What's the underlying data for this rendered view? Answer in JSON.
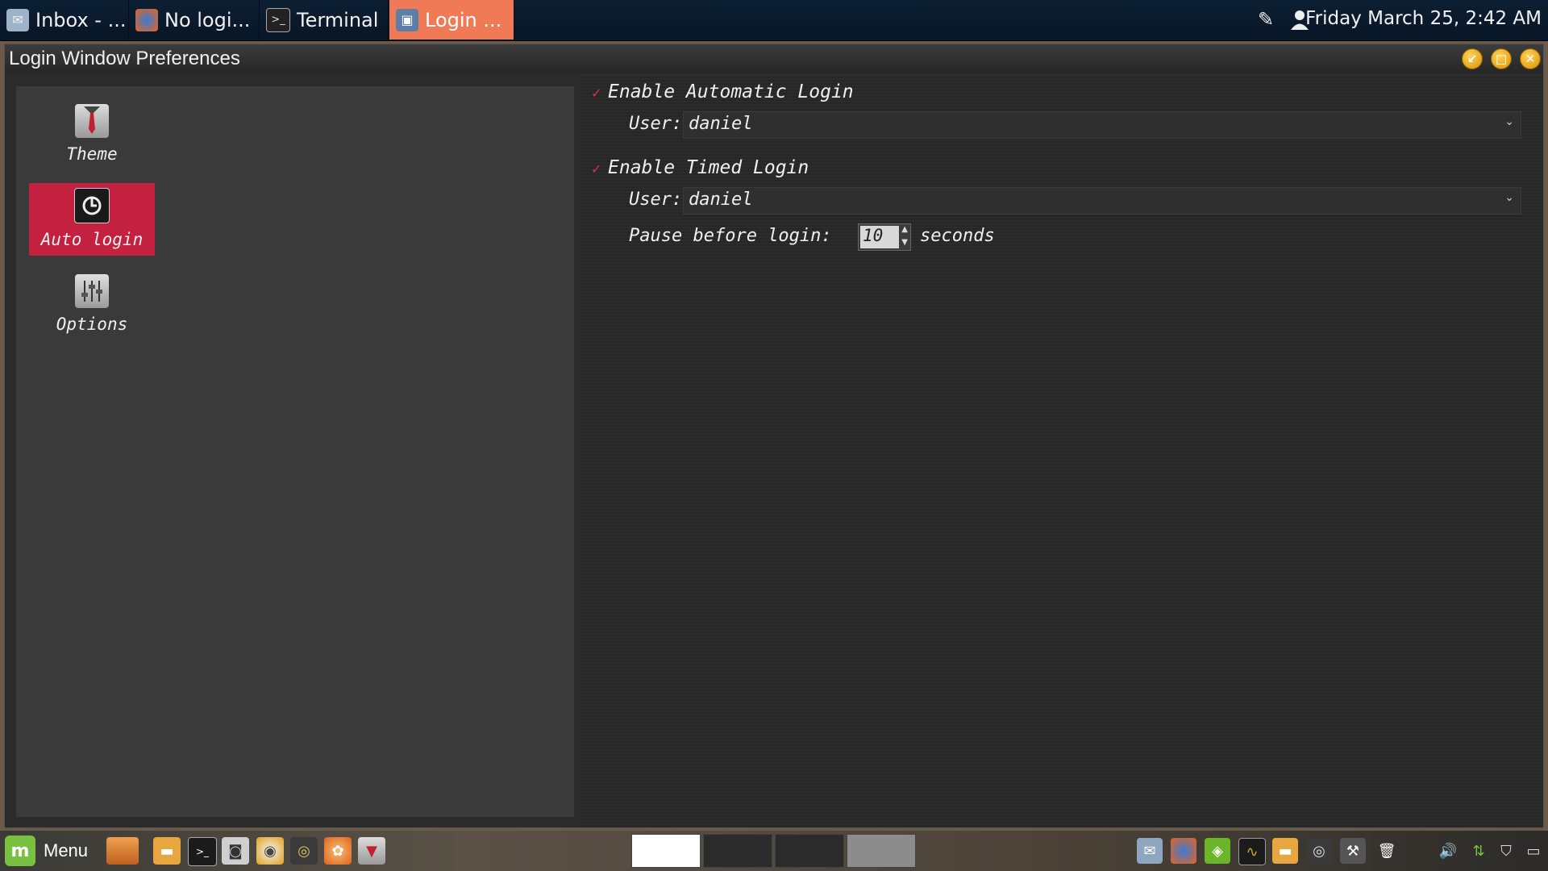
{
  "taskbar": {
    "tasks": [
      {
        "label": "Inbox - ...",
        "icon": "mail-icon"
      },
      {
        "label": "No logi...",
        "icon": "firefox-icon"
      },
      {
        "label": "Terminal",
        "icon": "terminal-icon"
      },
      {
        "label": "Login ...",
        "icon": "login-window-icon",
        "active": true
      }
    ],
    "clock": "Friday March 25,  2:42 AM"
  },
  "window": {
    "title": "Login Window Preferences"
  },
  "sidebar": {
    "items": [
      {
        "label": "Theme",
        "icon": "theme-tie-icon"
      },
      {
        "label": "Auto login",
        "icon": "auto-login-power-icon",
        "selected": true
      },
      {
        "label": "Options",
        "icon": "options-sliders-icon"
      }
    ]
  },
  "autologin": {
    "automatic": {
      "label": "Enable Automatic Login",
      "checked": true,
      "user_label": "User:",
      "user_value": "daniel"
    },
    "timed": {
      "label": "Enable Timed Login",
      "checked": true,
      "user_label": "User:",
      "user_value": "daniel",
      "pause_label": "Pause before login:",
      "pause_value": "10",
      "pause_unit": "seconds"
    }
  },
  "bottom_panel": {
    "menu_label": "Menu"
  },
  "colors": {
    "accent_selected": "#c42040",
    "active_task": "#f07a55",
    "check": "#e0304a"
  }
}
